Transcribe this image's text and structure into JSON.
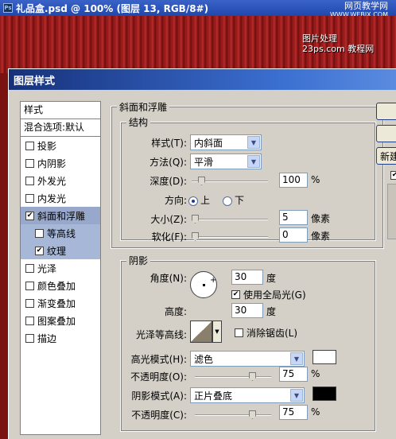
{
  "document": {
    "title": "礼品盒.psd @ 100% (图层 13, RGB/8#)",
    "watermark_top": "网页教学网",
    "watermark_top_sub": "WWW.WEBJX.COM",
    "watermark_mid_line1": "图片处理",
    "watermark_mid_line2": "23ps.com 教程网"
  },
  "dialog": {
    "title": "图层样式",
    "styles_header": "样式",
    "blend_options": "混合选项:默认",
    "items": [
      {
        "label": "投影",
        "checked": false
      },
      {
        "label": "内阴影",
        "checked": false
      },
      {
        "label": "外发光",
        "checked": false
      },
      {
        "label": "内发光",
        "checked": false
      },
      {
        "label": "斜面和浮雕",
        "checked": true
      },
      {
        "label": "等高线",
        "checked": false
      },
      {
        "label": "纹理",
        "checked": true
      },
      {
        "label": "光泽",
        "checked": false
      },
      {
        "label": "颜色叠加",
        "checked": false
      },
      {
        "label": "渐变叠加",
        "checked": false
      },
      {
        "label": "图案叠加",
        "checked": false
      },
      {
        "label": "描边",
        "checked": false
      }
    ],
    "new_style_button": "新建",
    "bevel": {
      "section_title": "斜面和浮雕",
      "structure_title": "结构",
      "style_label": "样式(T):",
      "style_value": "内斜面",
      "technique_label": "方法(Q):",
      "technique_value": "平滑",
      "depth_label": "深度(D):",
      "depth_value": "100",
      "depth_unit": "%",
      "direction_label": "方向:",
      "direction_up": "上",
      "direction_down": "下",
      "size_label": "大小(Z):",
      "size_value": "5",
      "size_unit": "像素",
      "soften_label": "软化(F):",
      "soften_value": "0",
      "soften_unit": "像素"
    },
    "shading": {
      "title": "阴影",
      "angle_label": "角度(N):",
      "angle_value": "30",
      "angle_unit": "度",
      "global_light_label": "使用全局光(G)",
      "altitude_label": "高度:",
      "altitude_value": "30",
      "altitude_unit": "度",
      "gloss_contour_label": "光泽等高线:",
      "anti_aliased_label": "消除锯齿(L)",
      "highlight_mode_label": "高光模式(H):",
      "highlight_mode_value": "滤色",
      "highlight_color": "#ffffff",
      "highlight_opacity_label": "不透明度(O):",
      "highlight_opacity_value": "75",
      "highlight_opacity_unit": "%",
      "shadow_mode_label": "阴影模式(A):",
      "shadow_mode_value": "正片叠底",
      "shadow_color": "#000000",
      "shadow_opacity_label": "不透明度(C):",
      "shadow_opacity_value": "75",
      "shadow_opacity_unit": "%"
    }
  }
}
